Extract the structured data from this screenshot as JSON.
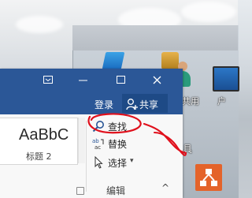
{
  "desktop": {
    "label_public": "公共用",
    "label_public_2": "户",
    "label_partial_1": "·",
    "label_partial_2": "具"
  },
  "window": {
    "login": "登录",
    "share": "共享"
  },
  "ribbon": {
    "style_sample": "AaBbC",
    "style_name": "标题 2",
    "commands": {
      "find": "查找",
      "replace": "替换",
      "select": "选择"
    },
    "group_label": "编辑",
    "collapse_icon": "^"
  },
  "annotation": {
    "color": "#e0101c"
  }
}
